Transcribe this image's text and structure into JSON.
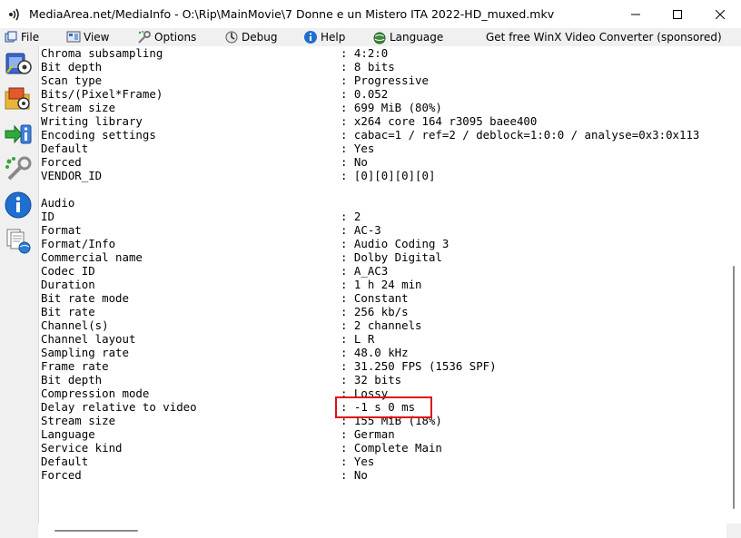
{
  "window": {
    "title": "MediaArea.net/MediaInfo - O:\\Rip\\MainMovie\\7 Donne e un Mistero ITA 2022-HD_muxed.mkv"
  },
  "menu": {
    "file": "File",
    "view": "View",
    "options": "Options",
    "debug": "Debug",
    "help": "Help",
    "language": "Language",
    "sponsor": "Get free WinX Video Converter (sponsored)"
  },
  "rows": [
    {
      "k": "Chroma subsampling",
      "v": ": 4:2:0"
    },
    {
      "k": "Bit depth",
      "v": ": 8 bits"
    },
    {
      "k": "Scan type",
      "v": ": Progressive"
    },
    {
      "k": "Bits/(Pixel*Frame)",
      "v": ": 0.052"
    },
    {
      "k": "Stream size",
      "v": ": 699 MiB (80%)"
    },
    {
      "k": "Writing library",
      "v": ": x264 core 164 r3095 baee400"
    },
    {
      "k": "Encoding settings",
      "v": ": cabac=1 / ref=2 / deblock=1:0:0 / analyse=0x3:0x113"
    },
    {
      "k": "Default",
      "v": ": Yes"
    },
    {
      "k": "Forced",
      "v": ": No"
    },
    {
      "k": "VENDOR_ID",
      "v": ": [0][0][0][0]"
    },
    {
      "k": "",
      "v": ""
    },
    {
      "k": "Audio",
      "v": ""
    },
    {
      "k": "ID",
      "v": ": 2"
    },
    {
      "k": "Format",
      "v": ": AC-3"
    },
    {
      "k": "Format/Info",
      "v": ": Audio Coding 3"
    },
    {
      "k": "Commercial name",
      "v": ": Dolby Digital"
    },
    {
      "k": "Codec ID",
      "v": ": A_AC3"
    },
    {
      "k": "Duration",
      "v": ": 1 h 24 min"
    },
    {
      "k": "Bit rate mode",
      "v": ": Constant"
    },
    {
      "k": "Bit rate",
      "v": ": 256 kb/s"
    },
    {
      "k": "Channel(s)",
      "v": ": 2 channels"
    },
    {
      "k": "Channel layout",
      "v": ": L R"
    },
    {
      "k": "Sampling rate",
      "v": ": 48.0 kHz"
    },
    {
      "k": "Frame rate",
      "v": ": 31.250 FPS (1536 SPF)"
    },
    {
      "k": "Bit depth",
      "v": ": 32 bits"
    },
    {
      "k": "Compression mode",
      "v": ": Lossy"
    },
    {
      "k": "Delay relative to video",
      "v": ": -1 s 0 ms"
    },
    {
      "k": "Stream size",
      "v": ": 155 MiB (18%)"
    },
    {
      "k": "Language",
      "v": ": German"
    },
    {
      "k": "Service kind",
      "v": ": Complete Main"
    },
    {
      "k": "Default",
      "v": ": Yes"
    },
    {
      "k": "Forced",
      "v": ": No"
    }
  ],
  "colors": {
    "highlight": "#e01010",
    "toolbar_blue": "#1a6fd1"
  }
}
